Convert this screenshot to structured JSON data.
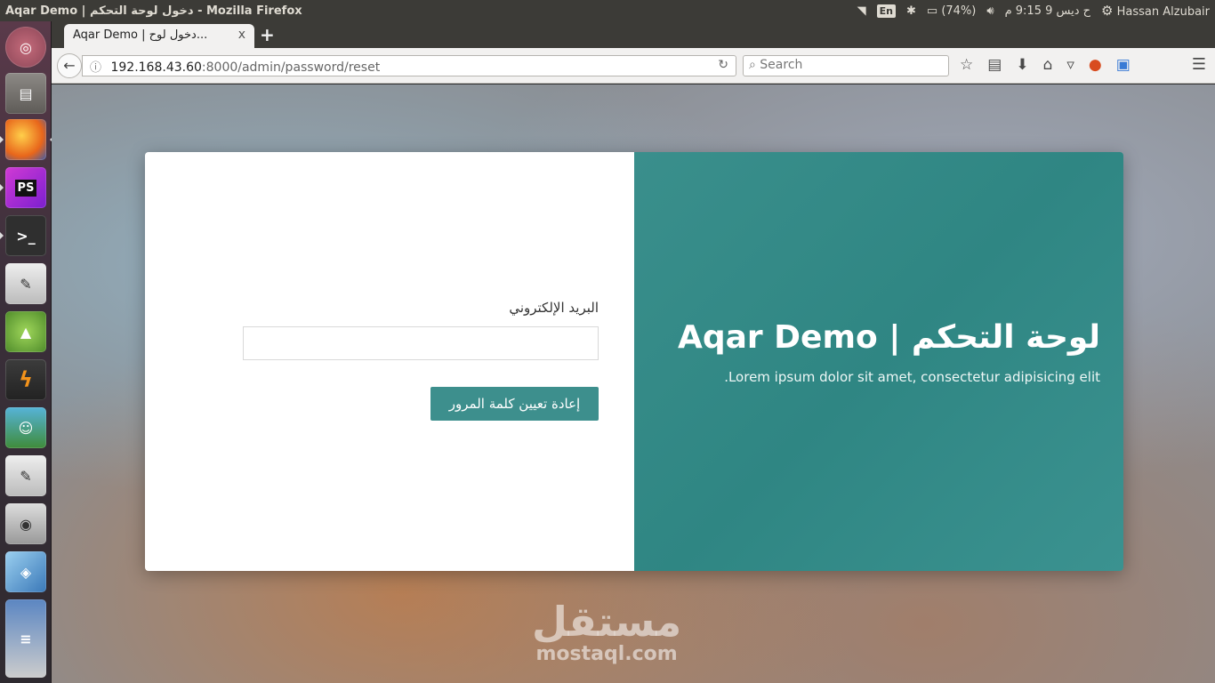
{
  "system": {
    "window_title": "Aqar Demo | دخول لوحة التحكم - Mozilla Firefox",
    "keyboard_layout": "En",
    "battery": "(74%)",
    "clock": "ح ديس 9 9:15 م",
    "user": "Hassan Alzubair"
  },
  "launcher": {
    "apps": [
      "ubuntu-dash",
      "files",
      "firefox",
      "phpstorm",
      "terminal",
      "text-editor",
      "android-studio",
      "filezilla",
      "avatar-app",
      "text-editor-2",
      "camera",
      "virtualbox",
      "app-stack"
    ],
    "phpstorm_label": "PS"
  },
  "browser": {
    "tab_title": "Aqar Demo | دخول لوح...",
    "tab_close": "x",
    "new_tab": "+",
    "url_host": "192.168.43.60",
    "url_rest": ":8000/admin/password/reset",
    "search_placeholder": "Search"
  },
  "page": {
    "email_label": "البريد الإلكتروني",
    "email_value": "",
    "reset_button": "إعادة تعيين كلمة المرور",
    "brand_title": "لوحة التحكم | Aqar Demo",
    "brand_subtitle": "Lorem ipsum dolor sit amet, consectetur adipisicing elit.",
    "watermark_ar": "مستقل",
    "watermark_en": "mostaql.com"
  },
  "colors": {
    "accent": "#3d8f8d",
    "brand_panel": "#2f8683",
    "topbar": "#3c3b37"
  }
}
